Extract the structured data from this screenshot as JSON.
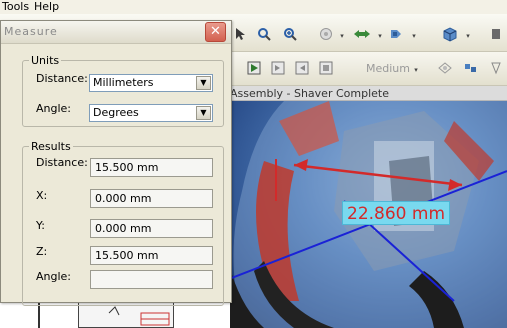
{
  "menubar": {
    "tools_label": "Tools",
    "help_label": "Help"
  },
  "toolbar2": {
    "zoom_quality_label": "Medium"
  },
  "document": {
    "title": "Assembly - Shaver Complete"
  },
  "viewport": {
    "measurement_label": "22.860 mm"
  },
  "measure_dialog": {
    "title": "Measure",
    "units": {
      "group_label": "Units",
      "distance_label": "Distance:",
      "distance_value": "Millimeters",
      "angle_label": "Angle:",
      "angle_value": "Degrees"
    },
    "results": {
      "group_label": "Results",
      "distance_label": "Distance:",
      "distance_value": "15.500 mm",
      "x_label": "X:",
      "x_value": "0.000 mm",
      "y_label": "Y:",
      "y_value": "0.000 mm",
      "z_label": "Z:",
      "z_value": "15.500 mm",
      "angle_label": "Angle:",
      "angle_value": ""
    }
  },
  "colors": {
    "measure_line": "#d32a2a",
    "axis_line": "#1a22d6",
    "label_background": "#79d9ef",
    "close_button": "#d3604f"
  },
  "icons": [
    "zoom-in-icon",
    "zoom-window-icon",
    "orbit-icon",
    "pan-icon",
    "view-icon",
    "part-icon",
    "play-icon",
    "step-icon",
    "animation-icon",
    "explode-icon"
  ]
}
